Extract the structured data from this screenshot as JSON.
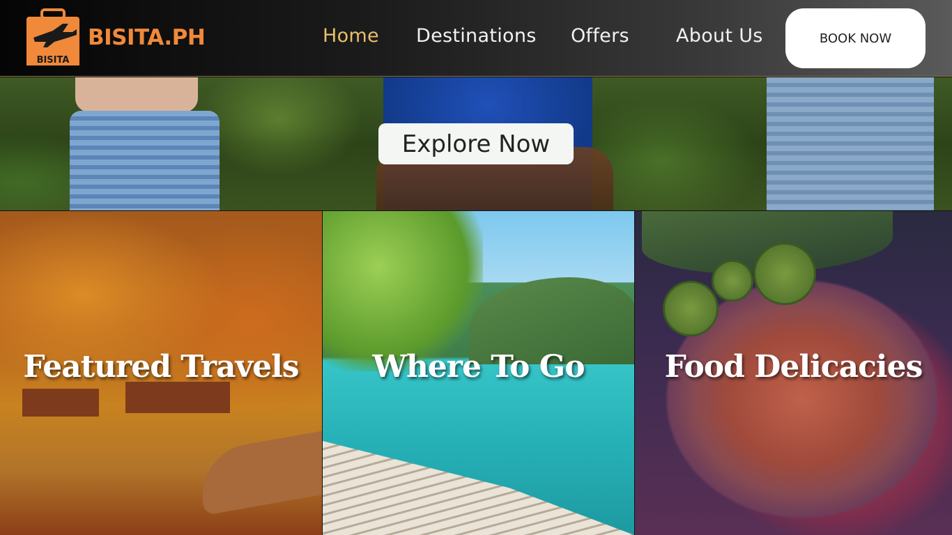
{
  "brand": {
    "name": "BISITA.PH",
    "mark_text": "BISITA",
    "color": "#f0893a"
  },
  "nav": {
    "items": [
      {
        "label": "Home",
        "active": true
      },
      {
        "label": "Destinations",
        "active": false
      },
      {
        "label": "Offers",
        "active": false
      },
      {
        "label": "About Us",
        "active": false
      }
    ],
    "active_color": "#e7c06a"
  },
  "cta": {
    "book_label": "BOOK NOW"
  },
  "hero": {
    "explore_label": "Explore Now"
  },
  "cards": [
    {
      "title": "Featured Travels"
    },
    {
      "title": "Where To Go"
    },
    {
      "title": "Food Delicacies"
    }
  ]
}
